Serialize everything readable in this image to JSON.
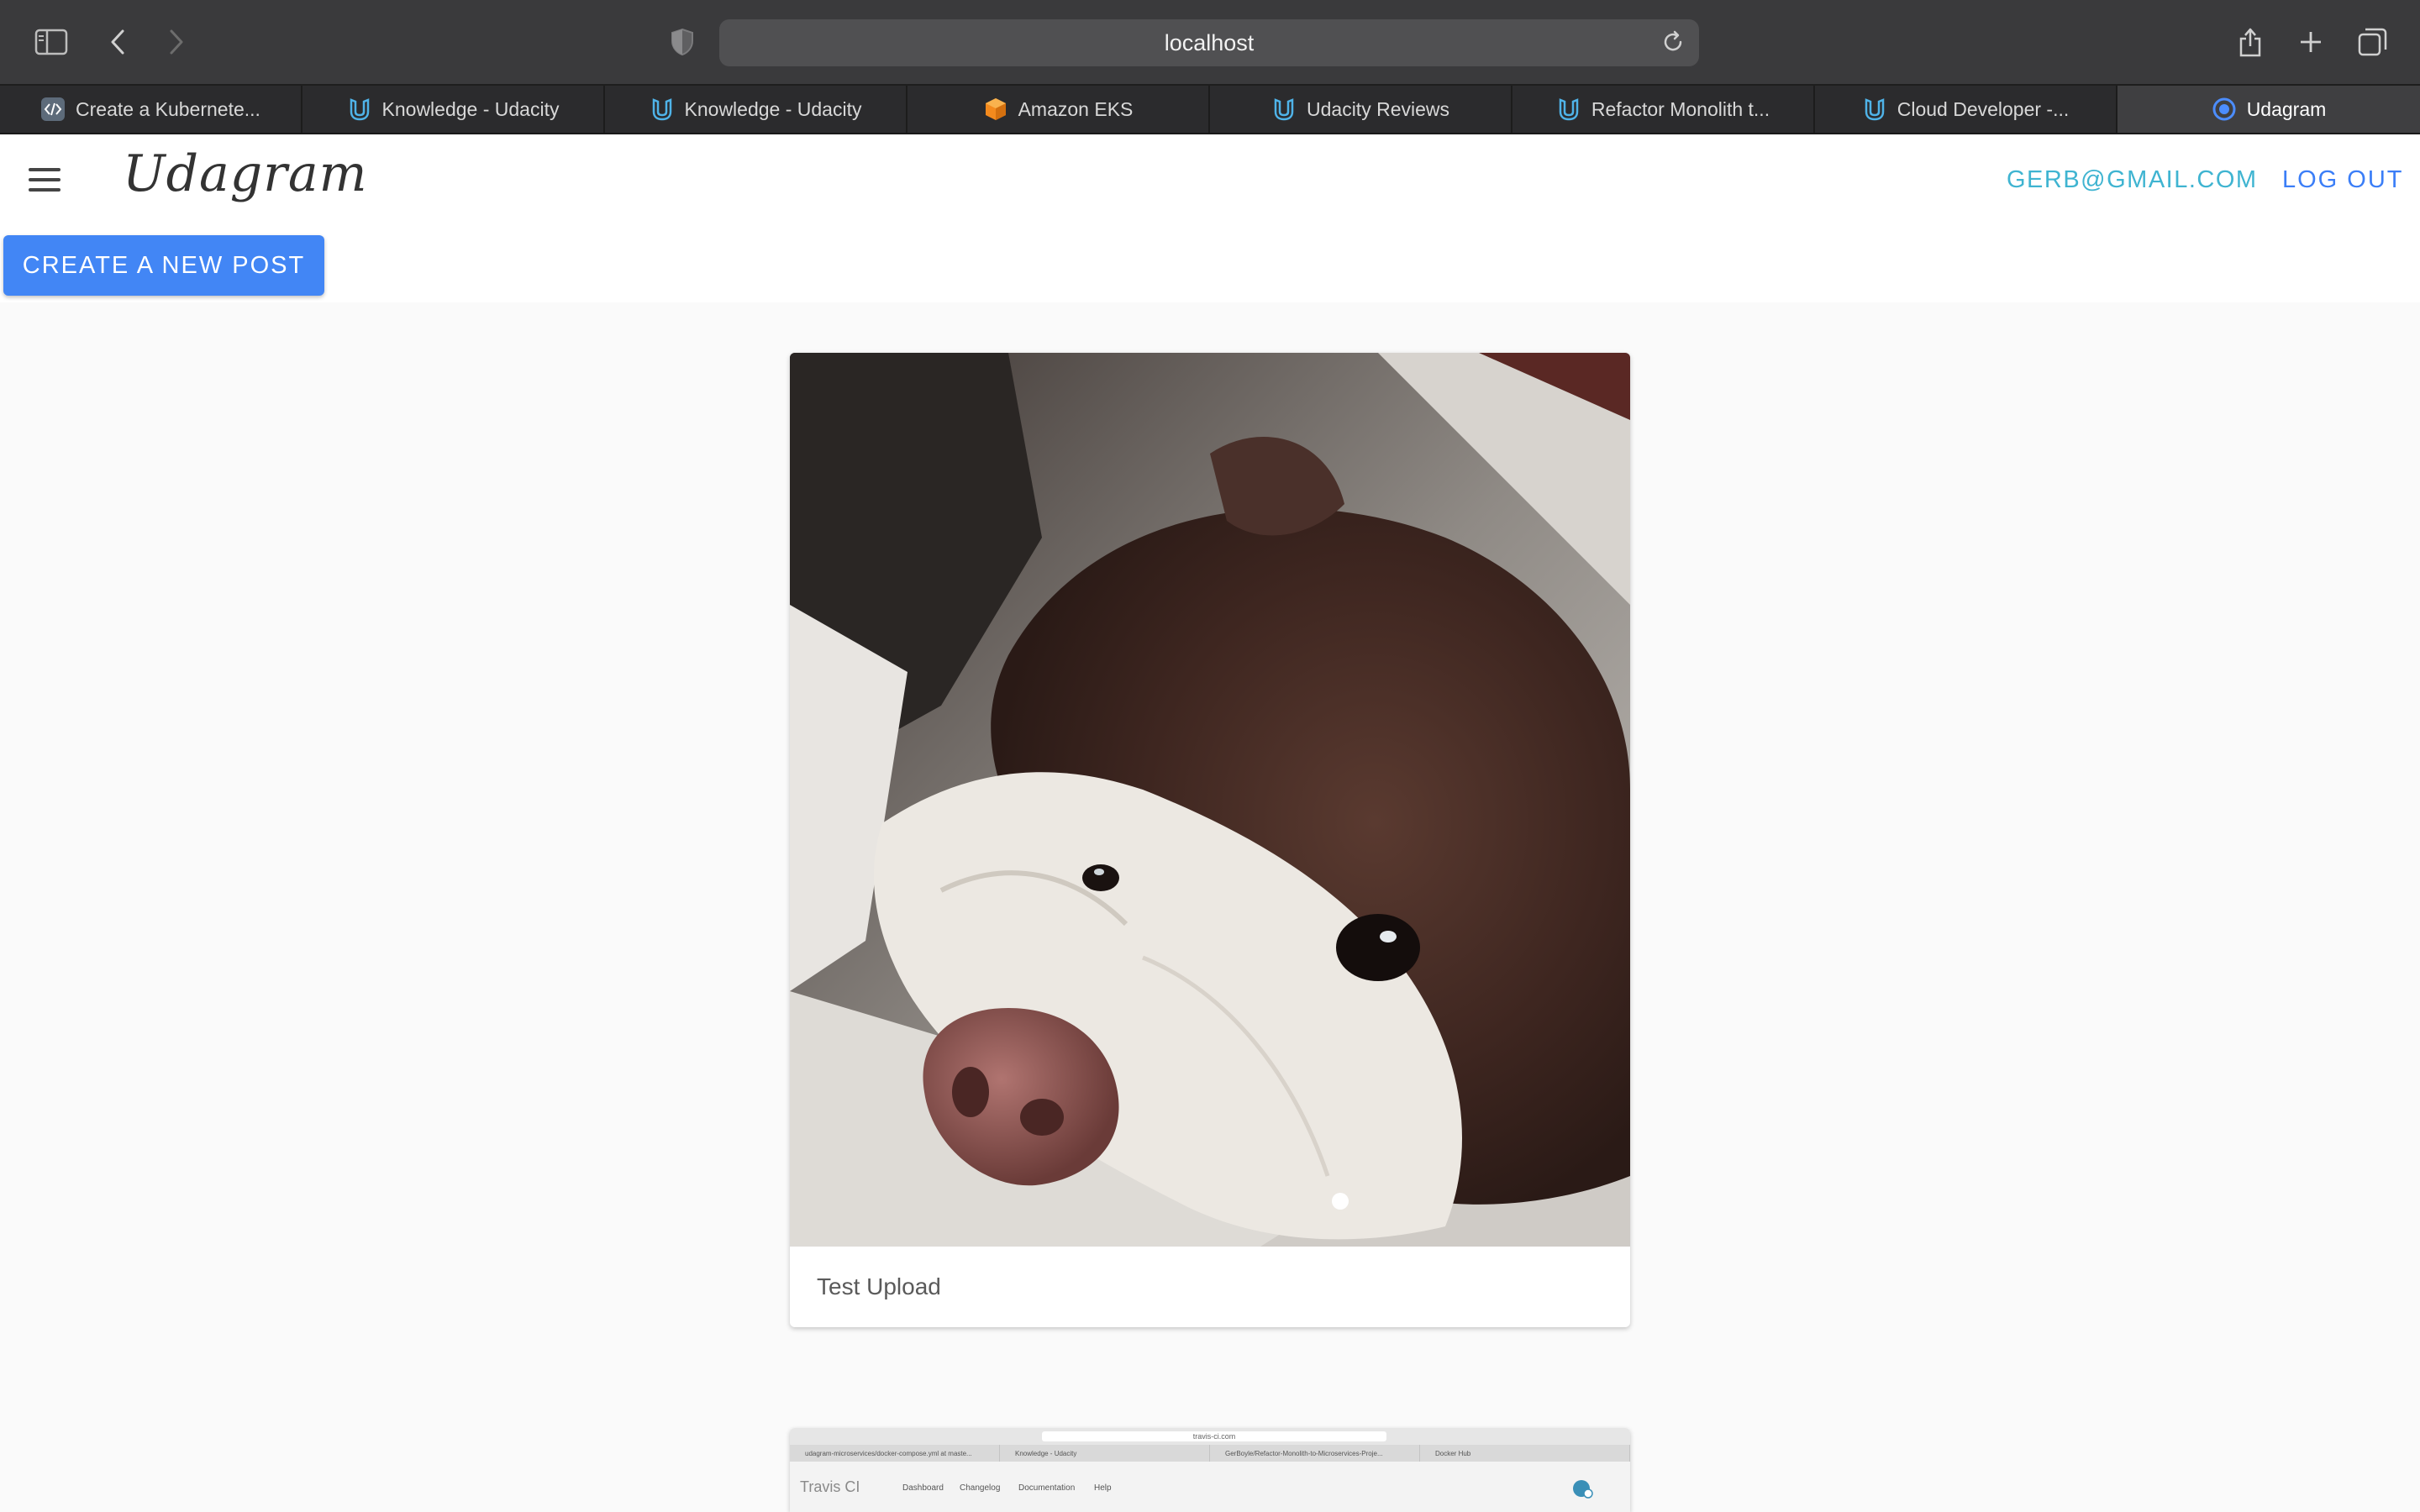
{
  "browser": {
    "url": "localhost",
    "tabs": [
      {
        "label": "Create a Kubernete...",
        "icon": "code-icon"
      },
      {
        "label": "Knowledge - Udacity",
        "icon": "udacity-icon"
      },
      {
        "label": "Knowledge - Udacity",
        "icon": "udacity-icon"
      },
      {
        "label": "Amazon EKS",
        "icon": "aws-cube-icon"
      },
      {
        "label": "Udacity Reviews",
        "icon": "udacity-icon"
      },
      {
        "label": "Refactor Monolith t...",
        "icon": "udacity-icon"
      },
      {
        "label": "Cloud Developer -...",
        "icon": "udacity-icon"
      },
      {
        "label": "Udagram",
        "icon": "ionic-icon",
        "active": true
      }
    ]
  },
  "header": {
    "logo": "Udagram",
    "user_email": "GERB@GMAIL.COM",
    "logout_label": "LOG OUT"
  },
  "actions": {
    "create_post_label": "CREATE A NEW POST"
  },
  "feed": {
    "items": [
      {
        "caption": "Test Upload",
        "image": "dog-photo"
      },
      {
        "caption": "",
        "image": "travis-ci-screenshot",
        "screenshot_text": {
          "url": "travis-ci.com",
          "tabs": [
            "udagram-microservices/docker-compose.yml at maste...",
            "Knowledge - Udacity",
            "GerBoyle/Refactor-Monolith-to-Microservices-Proje...",
            "Docker Hub"
          ],
          "brand": "Travis CI",
          "nav": [
            "Dashboard",
            "Changelog",
            "Documentation",
            "Help"
          ]
        }
      }
    ]
  },
  "colors": {
    "primary": "#4286f5",
    "email": "#3fb4d1",
    "logout": "#3b7ef7",
    "chrome": "#3a3a3c"
  }
}
